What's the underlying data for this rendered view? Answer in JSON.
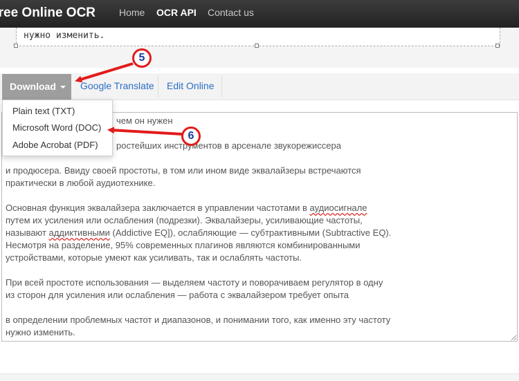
{
  "navbar": {
    "brand": "Free Online OCR",
    "links": [
      "Home",
      "OCR API",
      "Contact us"
    ]
  },
  "top_textarea": {
    "last_line": "нужно изменить."
  },
  "toolbar": {
    "download_label": "Download",
    "google_translate": "Google Translate",
    "edit_online": "Edit Online"
  },
  "download_menu": {
    "items": [
      "Plain text (TXT)",
      "Microsoft Word (DOC)",
      "Adobe Acrobat (PDF)"
    ]
  },
  "annotations": {
    "step5": "5",
    "step6": "6"
  },
  "result_text": {
    "lines": [
      "чем он нужен",
      "ростейших инструментов в арсенале звукорежиссера",
      "",
      "и продюсера. Ввиду своей простоты, в том или ином виде эквалайзеры встречаются",
      "практически в любой аудиотехнике.",
      "",
      "Основная функция эквалайзера заключается в управлении частотами в аудиосигнале",
      "путем их усиления или ослабления (подрезки). Эквалайзеры, усиливающие частоты,",
      "называют аддиктивными (Addictive EQ]), ослабляющие — субтрактивными (Subtractive EQ).",
      "Несмотря на разделение, 95% современных плагинов являются комбинированными",
      "устройствами, которые умеют как усиливать, так и ослаблять частоты.",
      "",
      "При всей простоте использования — выделяем частоту и поворачиваем регулятор в одну",
      "из сторон для усиления или ослабления — работа с эквалайзером требует опыта",
      "",
      "в определении проблемных частот и диапазонов, и понимании того, как именно эту частоту",
      "нужно изменить."
    ]
  },
  "colors": {
    "accent_link": "#2a6fc6",
    "annotation_red": "#e21b1b",
    "badge_digit": "#1b3c9e"
  }
}
